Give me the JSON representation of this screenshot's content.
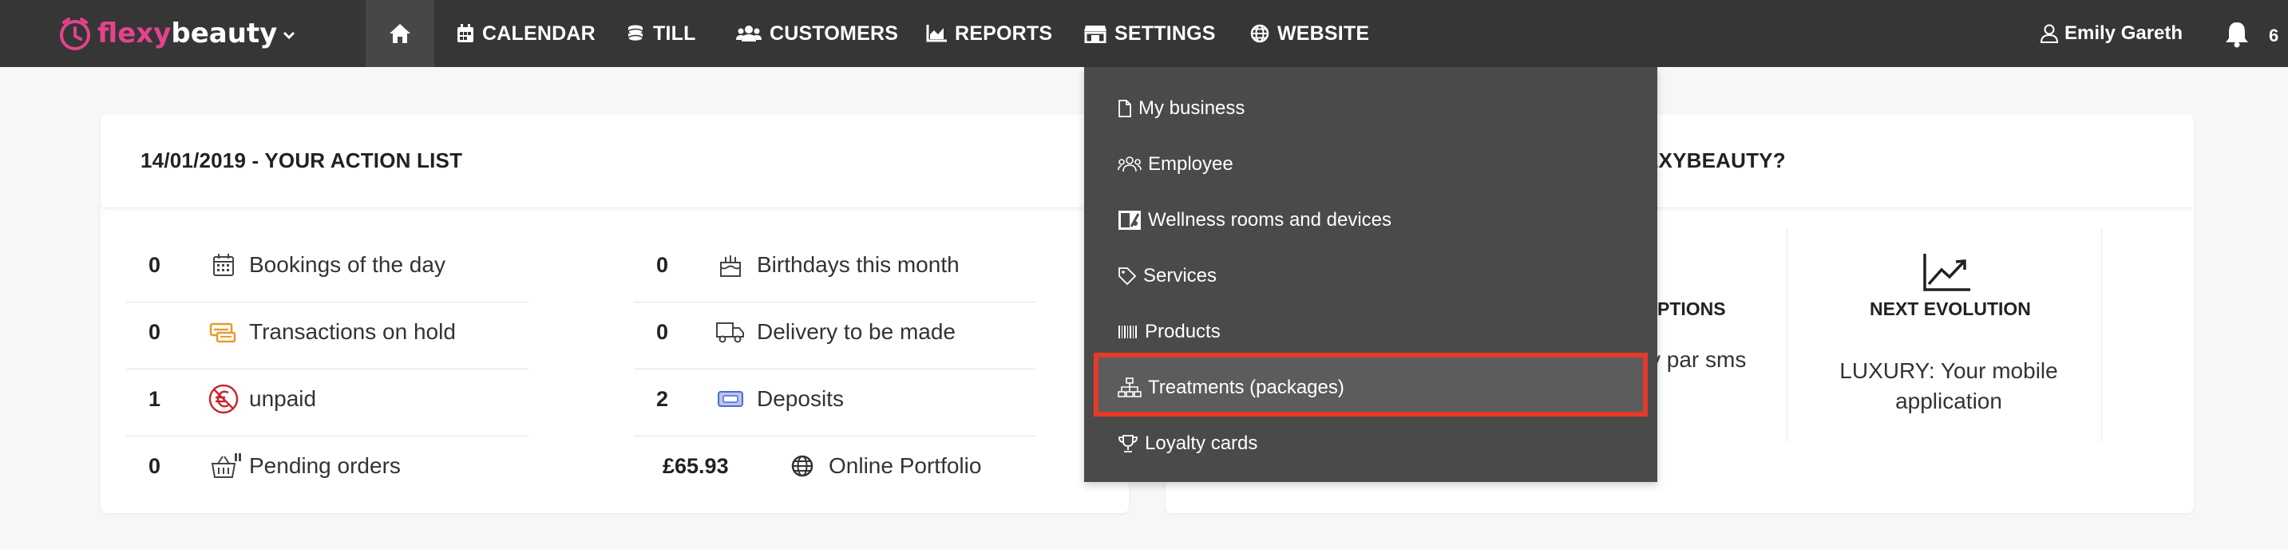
{
  "nav": {
    "brand_part1": "flexy",
    "brand_part2": "beauty",
    "items": [
      {
        "label": "CALENDAR"
      },
      {
        "label": "TILL"
      },
      {
        "label": "CUSTOMERS"
      },
      {
        "label": "REPORTS"
      },
      {
        "label": "SETTINGS"
      },
      {
        "label": "WEBSITE"
      }
    ],
    "user_name": "Emily Gareth",
    "notification_count": "6"
  },
  "action_card": {
    "title": "14/01/2019 - YOUR ACTION LIST",
    "rows": [
      {
        "value": "0",
        "label": "Bookings of the day",
        "icon": "calendar-icon"
      },
      {
        "value": "0",
        "label": "Birthdays this month",
        "icon": "cake-icon"
      },
      {
        "value": "0",
        "label": "Transactions on hold",
        "icon": "ticket-icon"
      },
      {
        "value": "0",
        "label": "Delivery to be made",
        "icon": "truck-icon"
      },
      {
        "value": "1",
        "label": "unpaid",
        "icon": "no-euro-icon"
      },
      {
        "value": "2",
        "label": "Deposits",
        "icon": "deposit-icon"
      },
      {
        "value": "0",
        "label": "Pending orders",
        "icon": "basket-icon"
      },
      {
        "value": "£65.93",
        "label": "Online Portfolio",
        "icon": "globe-icon"
      }
    ]
  },
  "news_card": {
    "title_fragment": "EXYBEAUTY?",
    "col1_title": "PTIONS",
    "col1_text": "v par sms",
    "col2_title": "NEXT EVOLUTION",
    "col2_text": "LUXURY: Your mobile application"
  },
  "settings_menu": {
    "items": [
      {
        "label": "My business",
        "icon": "document-icon"
      },
      {
        "label": "Employee",
        "icon": "users-icon"
      },
      {
        "label": "Wellness rooms and devices",
        "icon": "room-icon"
      },
      {
        "label": "Services",
        "icon": "tag-icon"
      },
      {
        "label": "Products",
        "icon": "barcode-icon"
      },
      {
        "label": "Treatments (packages)",
        "icon": "sitemap-icon"
      },
      {
        "label": "Loyalty cards",
        "icon": "trophy-icon"
      }
    ]
  },
  "colors": {
    "nav_bg": "#363636",
    "brand_pink": "#e5428e",
    "highlight_red": "#e53a2a",
    "dropdown_bg": "#4a4a4a"
  }
}
